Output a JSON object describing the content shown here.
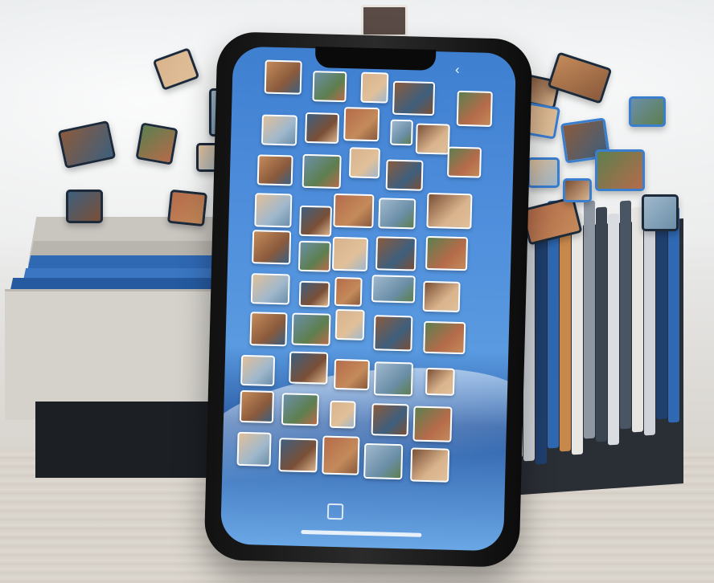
{
  "scene": {
    "subject": "",
    "colors": {
      "screen": "#4f8fdc",
      "desk": "#d6d0c8",
      "organizer_dark": "#1c1f24",
      "folder_blue": "#2f68b3"
    }
  },
  "photo_palette": [
    "#c48a5a",
    "#6b8fa8",
    "#d9b38c",
    "#8a5a3c",
    "#5d7f4f",
    "#e0c09a",
    "#3e5f7d",
    "#b56b4a",
    "#a0b8cc",
    "#7a4f36"
  ]
}
